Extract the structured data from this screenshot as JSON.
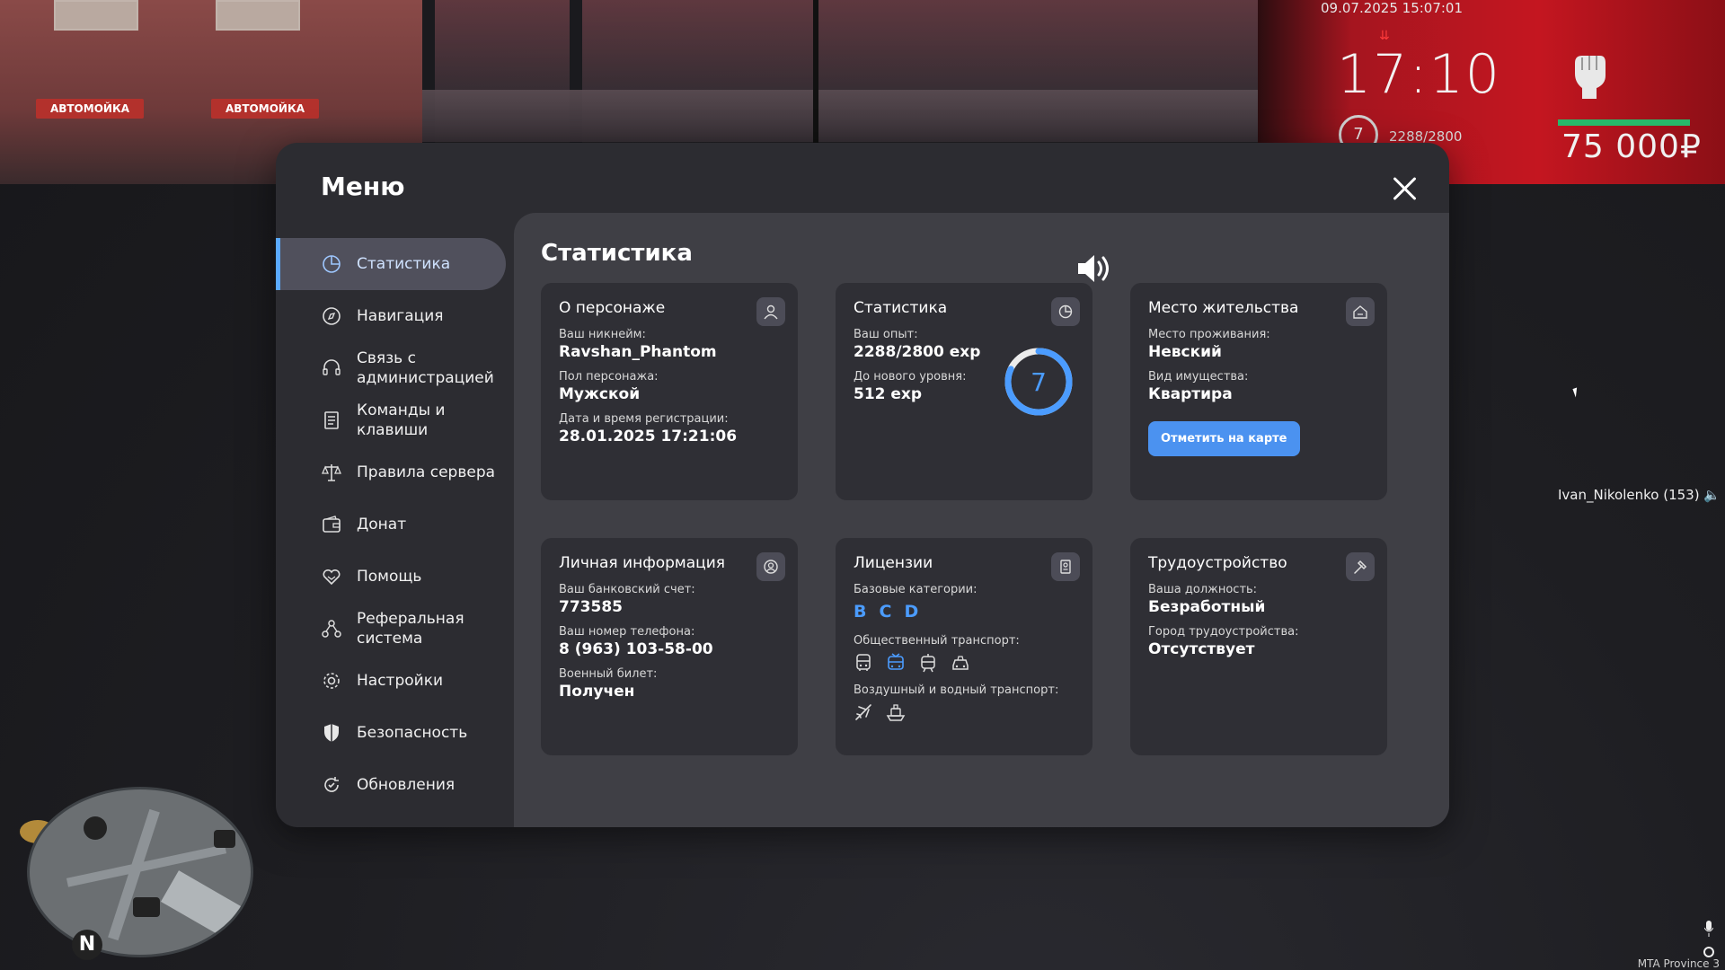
{
  "hud": {
    "datetime": "09.07.2025 15:07:01",
    "time": "17:10",
    "level": "7",
    "exp": "2288/2800",
    "money": "75 000₽",
    "player": "Ivan_Nikolenko (153)",
    "footer": "MTA Province 3",
    "health_fraction": 1.0
  },
  "bg_signs": [
    "АВТОМОЙКА",
    "АВТОМОЙКА"
  ],
  "menu": {
    "title": "Меню",
    "sidebar": [
      {
        "label": "Статистика",
        "icon": "pie-chart-icon",
        "active": true
      },
      {
        "label": "Навигация",
        "icon": "compass-icon"
      },
      {
        "label": "Связь с\nадминистрацией",
        "icon": "headset-icon"
      },
      {
        "label": "Команды и\nклавиши",
        "icon": "document-icon"
      },
      {
        "label": "Правила сервера",
        "icon": "scales-icon"
      },
      {
        "label": "Донат",
        "icon": "wallet-icon"
      },
      {
        "label": "Помощь",
        "icon": "heart-hand-icon"
      },
      {
        "label": "Реферальная\nсистема",
        "icon": "network-icon"
      },
      {
        "label": "Настройки",
        "icon": "gear-icon"
      },
      {
        "label": "Безопасность",
        "icon": "shield-icon"
      },
      {
        "label": "Обновления",
        "icon": "refresh-icon"
      }
    ]
  },
  "content": {
    "title": "Статистика",
    "character": {
      "title": "О персонаже",
      "nickname_label": "Ваш никнейм:",
      "nickname": "Ravshan_Phantom",
      "gender_label": "Пол персонажа:",
      "gender": "Мужской",
      "reg_label": "Дата и время регистрации:",
      "reg": "28.01.2025 17:21:06"
    },
    "stats": {
      "title": "Статистика",
      "exp_label": "Ваш опыт:",
      "exp": "2288/2800 exp",
      "next_label": "До нового уровня:",
      "next": "512 exp",
      "level": "7",
      "progress_fraction": 0.817
    },
    "residence": {
      "title": "Место жительства",
      "place_label": "Место проживания:",
      "place": "Невский",
      "type_label": "Вид имущества:",
      "type": "Квартира",
      "button": "Отметить на карте"
    },
    "personal": {
      "title": "Личная информация",
      "bank_label": "Ваш банковский счет:",
      "bank": "773585",
      "phone_label": "Ваш номер телефона:",
      "phone": "8 (963) 103-58-00",
      "military_label": "Военный билет:",
      "military": "Получен"
    },
    "licenses": {
      "title": "Лицензии",
      "base_label": "Базовые категории:",
      "categories": [
        "B",
        "C",
        "D"
      ],
      "public_label": "Общественный транспорт:",
      "public": [
        "bus-icon",
        "trolleybus-icon",
        "tram-icon",
        "taxi-icon"
      ],
      "air_label": "Воздушный и водный транспорт:",
      "air": [
        "plane-icon",
        "boat-icon"
      ]
    },
    "job": {
      "title": "Трудоустройство",
      "position_label": "Ваша должность:",
      "position": "Безработный",
      "city_label": "Город трудоустройства:",
      "city": "Отсутствует"
    }
  },
  "colors": {
    "accent": "#5aa9ff",
    "button": "#4b92f0",
    "health": "#27b86a"
  }
}
